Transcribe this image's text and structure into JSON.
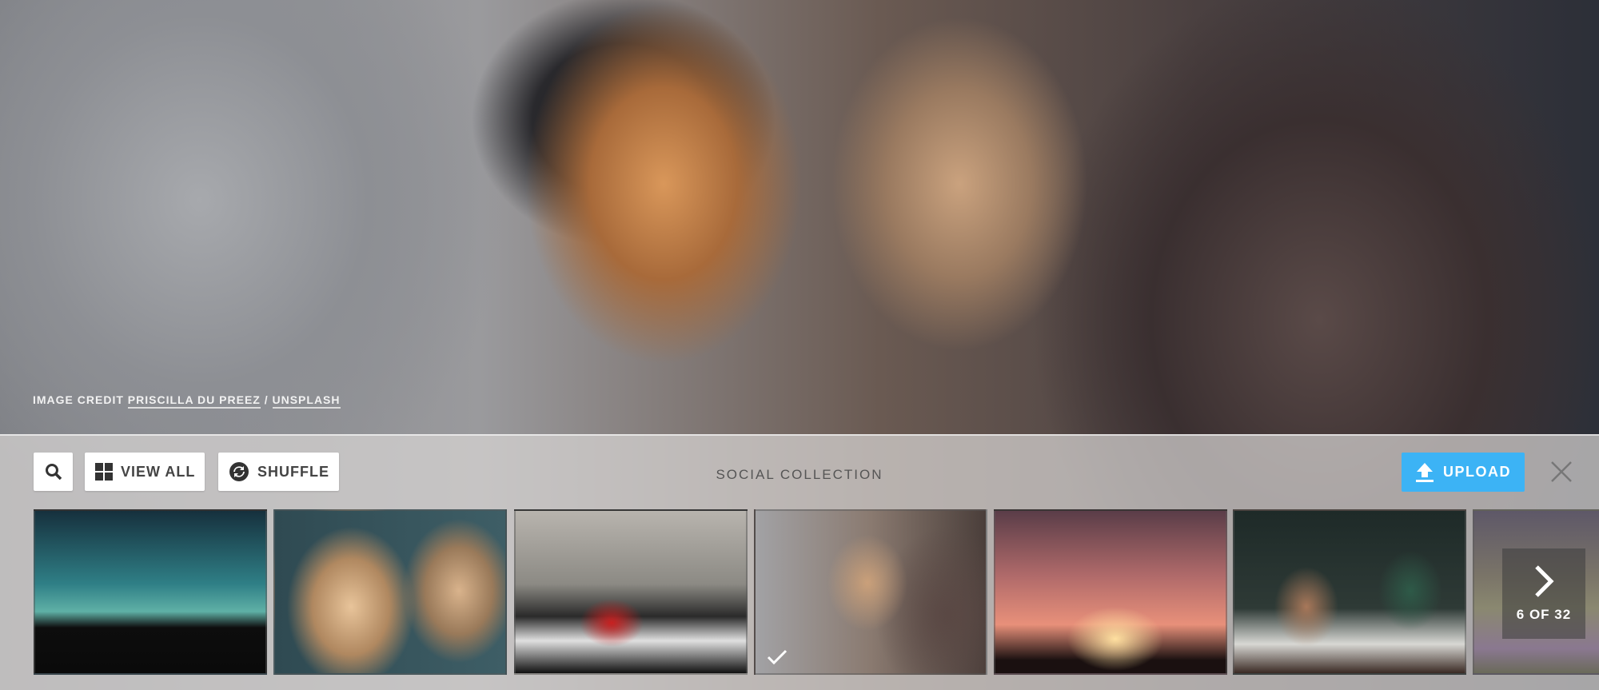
{
  "credit": {
    "prefix": "IMAGE CREDIT",
    "author": "PRISCILLA DU PREEZ",
    "separator": "/",
    "source": "UNSPLASH"
  },
  "toolbar": {
    "view_all": "VIEW ALL",
    "shuffle": "SHUFFLE",
    "upload": "UPLOAD",
    "collection_title": "SOCIAL COLLECTION"
  },
  "thumbnails": [
    {
      "subject": "crowd silhouette under night sky",
      "selected": false
    },
    {
      "subject": "two women laughing",
      "selected": false
    },
    {
      "subject": "two women with red cup on cliffs",
      "selected": false
    },
    {
      "subject": "friends laughing",
      "selected": true
    },
    {
      "subject": "couple silhouette at sunset",
      "selected": false
    },
    {
      "subject": "couple at cafe table",
      "selected": false
    },
    {
      "subject": "children walking in field",
      "selected": false
    }
  ],
  "pager": {
    "current": 6,
    "total": 32,
    "label": "6 OF 32"
  },
  "colors": {
    "accent": "#3cb3f5"
  }
}
